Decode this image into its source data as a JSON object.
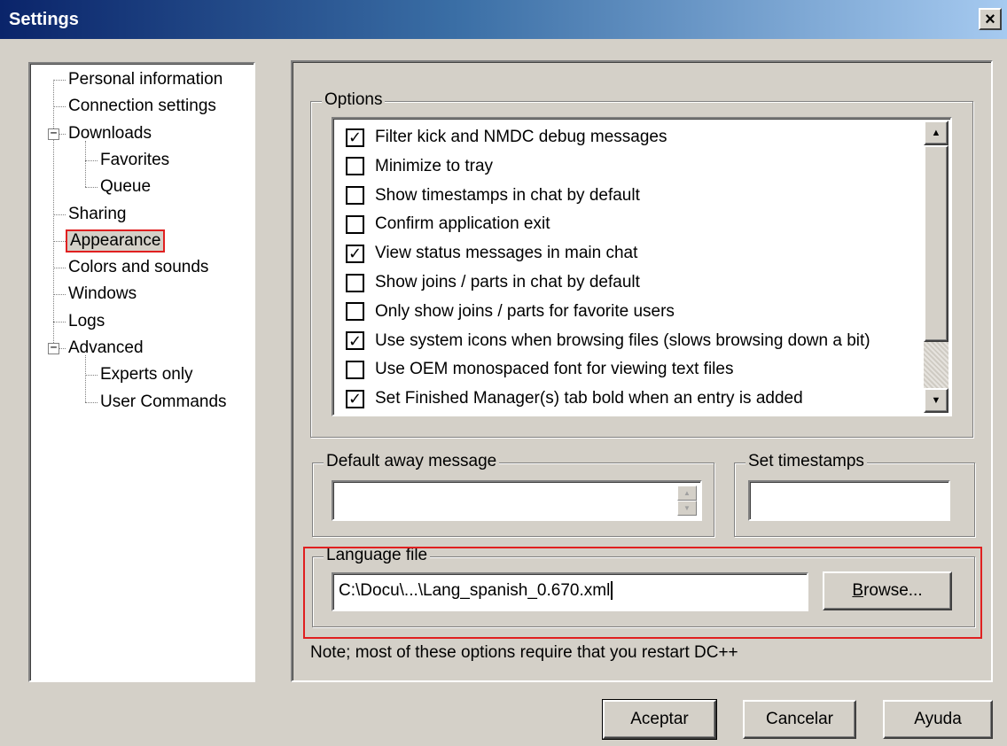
{
  "window": {
    "title": "Settings",
    "close_glyph": "×"
  },
  "tree": {
    "items": [
      {
        "label": "Personal information"
      },
      {
        "label": "Connection settings"
      },
      {
        "label": "Downloads",
        "expander": "−"
      },
      {
        "label": "Favorites"
      },
      {
        "label": "Queue"
      },
      {
        "label": "Sharing"
      },
      {
        "label": "Appearance",
        "selected": true
      },
      {
        "label": "Colors and sounds"
      },
      {
        "label": "Windows"
      },
      {
        "label": "Logs"
      },
      {
        "label": "Advanced",
        "expander": "−"
      },
      {
        "label": "Experts only"
      },
      {
        "label": "User Commands"
      }
    ]
  },
  "options": {
    "group_label": "Options",
    "check_glyph": "✓",
    "items": [
      {
        "label": "Filter kick and NMDC debug messages",
        "checked": true
      },
      {
        "label": "Minimize to tray",
        "checked": false
      },
      {
        "label": "Show timestamps in chat by default",
        "checked": false
      },
      {
        "label": "Confirm application exit",
        "checked": false
      },
      {
        "label": "View status messages in main chat",
        "checked": true
      },
      {
        "label": "Show joins / parts in chat by default",
        "checked": false
      },
      {
        "label": "Only show joins / parts for favorite users",
        "checked": false
      },
      {
        "label": "Use system icons when browsing files (slows browsing down a bit)",
        "checked": true
      },
      {
        "label": "Use OEM monospaced font for viewing text files",
        "checked": false
      },
      {
        "label": "Set Finished Manager(s) tab bold when an entry is added",
        "checked": true
      }
    ],
    "scroll_up": "▲",
    "scroll_down": "▼"
  },
  "away": {
    "group_label": "Default away message",
    "value": "",
    "spin_up": "▲",
    "spin_down": "▼"
  },
  "timestamps": {
    "group_label": "Set timestamps",
    "value": ""
  },
  "language": {
    "group_label": "Language file",
    "value": "C:\\Docu\\...\\Lang_spanish_0.670.xml",
    "browse_label": "Browse...",
    "browse_accel": "B"
  },
  "note": "Note; most of these options require that you restart DC++",
  "buttons": {
    "ok": "Aceptar",
    "cancel": "Cancelar",
    "help": "Ayuda"
  }
}
